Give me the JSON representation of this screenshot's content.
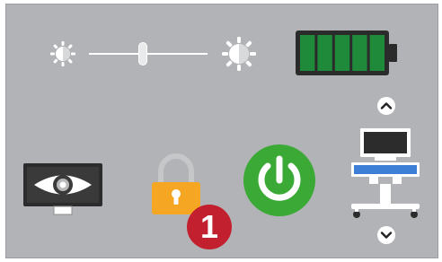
{
  "colors": {
    "panel_background": "#b1b3b6",
    "battery_fill": "#1f8a3a",
    "power_button": "#3aa935",
    "lock": "#f5a623",
    "badge": "#c3202f",
    "monitor_blue": "#3d7fd6"
  },
  "brightness": {
    "level": 0.45,
    "min_icon": "sun-low-icon",
    "max_icon": "sun-high-icon"
  },
  "battery": {
    "segments_filled": 5,
    "segments_total": 5
  },
  "lock_badge": {
    "count": "1"
  },
  "icons": {
    "eye": "eye-monitor-icon",
    "lock": "padlock-icon",
    "power": "power-icon",
    "workstation": "ultrasound-cart-icon",
    "up": "chevron-up-icon",
    "down": "chevron-down-icon"
  }
}
